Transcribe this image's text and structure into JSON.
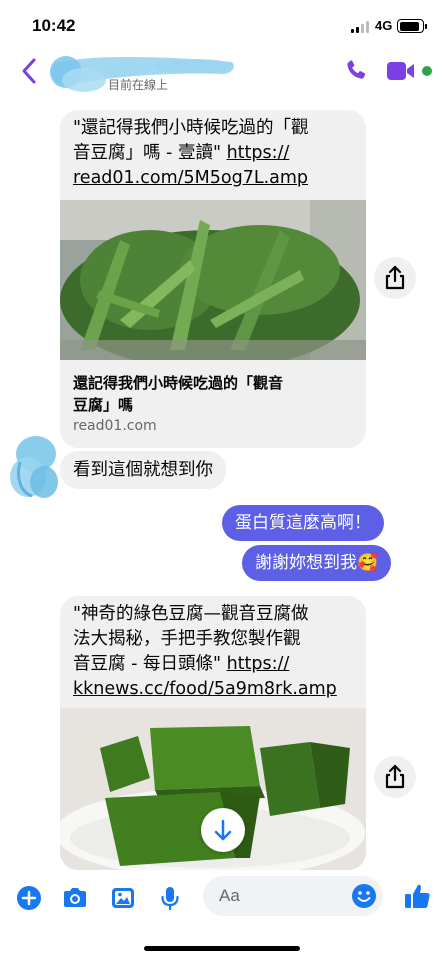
{
  "status_bar": {
    "time": "10:42",
    "network": "4G"
  },
  "header": {
    "presence": "目前在線上"
  },
  "colors": {
    "accent": "#7b3fe4",
    "bubble_purple": "#5d5fe6",
    "bubble_gray": "#f0f0f0",
    "online": "#31a24c",
    "bottom_icons": "#1877f2"
  },
  "messages": {
    "card1": {
      "text_line1": "\"還記得我們小時候吃過的「觀",
      "text_line2_a": "音豆腐」嗎 - 壹讀\" ",
      "text_line2_link": "https://",
      "text_line3_link": "read01.com/5M5og7L.amp",
      "preview_title_line1": "還記得我們小時候吃過的「觀音",
      "preview_title_line2": "豆腐」嗎",
      "preview_domain": "read01.com"
    },
    "received1": "看到這個就想到你",
    "sent1": "蛋白質這麼高啊！",
    "sent2": "謝謝妳想到我",
    "sent2_emoji": "🥰",
    "card2": {
      "text_line1": "\"神奇的綠色豆腐—觀音豆腐做",
      "text_line2": "法大揭秘，手把手教您製作觀",
      "text_line3_a": "音豆腐 - 每日頭條\" ",
      "text_line3_link": "https://",
      "text_line4_link": "kknews.cc/food/5a9m8rk.amp"
    }
  },
  "composer": {
    "placeholder": "Aa"
  }
}
